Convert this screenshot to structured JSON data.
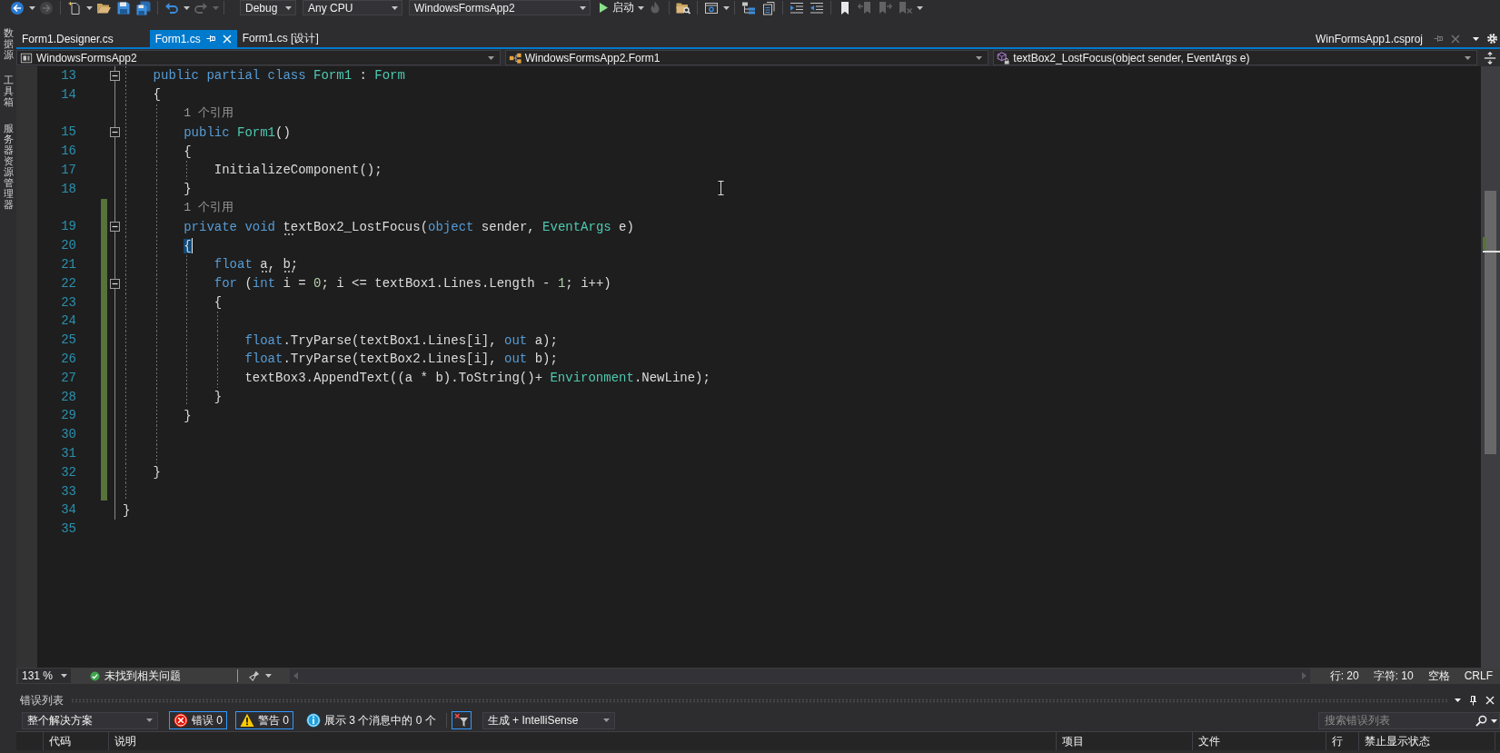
{
  "toolbar": [
    {
      "kind": "back",
      "disabled": false
    },
    {
      "kind": "caret",
      "disabled": false
    },
    {
      "kind": "forward",
      "disabled": true
    },
    {
      "kind": "separator"
    },
    {
      "kind": "new-item",
      "disabled": false
    },
    {
      "kind": "caret",
      "disabled": false
    },
    {
      "kind": "open",
      "disabled": false
    },
    {
      "kind": "save",
      "disabled": false
    },
    {
      "kind": "save-all",
      "disabled": false
    },
    {
      "kind": "separator"
    },
    {
      "kind": "undo",
      "disabled": false
    },
    {
      "kind": "caret",
      "disabled": false
    },
    {
      "kind": "redo",
      "disabled": true
    },
    {
      "kind": "caret",
      "disabled": true
    },
    {
      "kind": "separator"
    },
    {
      "kind": "combo",
      "value": "Debug"
    },
    {
      "kind": "combo",
      "value": "Any CPU"
    },
    {
      "kind": "combo",
      "value": "WindowsFormsApp2"
    },
    {
      "kind": "start",
      "label": "启动"
    },
    {
      "kind": "caret",
      "disabled": false
    },
    {
      "kind": "hot-reload",
      "disabled": true
    },
    {
      "kind": "separator"
    },
    {
      "kind": "find-in-files",
      "disabled": false
    },
    {
      "kind": "separator"
    },
    {
      "kind": "browser",
      "disabled": false
    },
    {
      "kind": "caret",
      "disabled": false
    },
    {
      "kind": "separator"
    },
    {
      "kind": "hierarchy",
      "disabled": false
    },
    {
      "kind": "pages",
      "disabled": false
    },
    {
      "kind": "separator"
    },
    {
      "kind": "indent",
      "disabled": false
    },
    {
      "kind": "outdent",
      "disabled": false
    },
    {
      "kind": "separator"
    },
    {
      "kind": "bookmark",
      "disabled": false
    },
    {
      "kind": "bookmark-previous",
      "disabled": true
    },
    {
      "kind": "bookmark-next",
      "disabled": true
    },
    {
      "kind": "bookmark-clear",
      "disabled": true
    },
    {
      "kind": "caret",
      "disabled": false
    }
  ],
  "side_tabs": [
    "数据源",
    "工具箱",
    "服务器资源管理器"
  ],
  "tabs": [
    {
      "label": "Form1.Designer.cs",
      "selected": false
    },
    {
      "label": "Form1.cs",
      "selected": true
    },
    {
      "label": "Form1.cs [设计]",
      "selected": false
    }
  ],
  "preview_tab": {
    "label": "WinFormsApp1.csproj"
  },
  "nav_bar": [
    {
      "kind": "project",
      "value": "WindowsFormsApp2"
    },
    {
      "kind": "class",
      "value": "WindowsFormsApp2.Form1"
    },
    {
      "kind": "member",
      "value": "textBox2_LostFocus(object sender, EventArgs e)"
    }
  ],
  "editor": {
    "lines": [
      {
        "kind": "block",
        "children": [
          {
            "kind": "code",
            "number": "13",
            "modified": false,
            "expanded": true,
            "tokens": [
              {
                "kind": "kw",
                "text": "public partial class "
              },
              {
                "kind": "type",
                "text": "Form1"
              },
              {
                "kind": "plain",
                "text": " : "
              },
              {
                "kind": "type",
                "text": "Form"
              }
            ]
          },
          {
            "kind": "code",
            "number": "14",
            "modified": false,
            "tokens": [
              {
                "kind": "plain",
                "text": "{"
              }
            ],
            "children": [
              {
                "kind": "codelens",
                "text": "1 个引用",
                "modified": false
              },
              {
                "kind": "code",
                "number": "15",
                "modified": false,
                "expanded": true,
                "tokens": [
                  {
                    "kind": "kw",
                    "text": "public "
                  },
                  {
                    "kind": "type",
                    "text": "Form1"
                  },
                  {
                    "kind": "plain",
                    "text": "()"
                  }
                ]
              },
              {
                "kind": "code",
                "number": "16",
                "modified": false,
                "tokens": [
                  {
                    "kind": "plain",
                    "text": "{"
                  }
                ],
                "children": [
                  {
                    "kind": "code",
                    "number": "17",
                    "modified": false,
                    "tokens": [
                      {
                        "kind": "plain",
                        "text": "InitializeComponent();"
                      }
                    ]
                  }
                ]
              },
              {
                "kind": "code",
                "number": "18",
                "modified": false,
                "tokens": [
                  {
                    "kind": "plain",
                    "text": "}"
                  }
                ]
              },
              {
                "kind": "codelens",
                "text": "1 个引用",
                "modified": true
              },
              {
                "kind": "code",
                "number": "19",
                "modified": true,
                "expanded": true,
                "tokens": [
                  {
                    "kind": "kw",
                    "text": "private void "
                  },
                  {
                    "kind": "hint",
                    "text": "textBox2_LostFocus"
                  },
                  {
                    "kind": "plain",
                    "text": "("
                  },
                  {
                    "kind": "kw",
                    "text": "object"
                  },
                  {
                    "kind": "plain",
                    "text": " sender, "
                  },
                  {
                    "kind": "type",
                    "text": "EventArgs"
                  },
                  {
                    "kind": "plain",
                    "text": " e)"
                  }
                ]
              },
              {
                "kind": "code",
                "number": "20",
                "modified": true,
                "cursor": true,
                "tokens": [
                  {
                    "kind": "brace-match",
                    "text": "{"
                  }
                ],
                "children": [
                  {
                    "kind": "code",
                    "number": "21",
                    "modified": true,
                    "tokens": [
                      {
                        "kind": "kw",
                        "text": "float "
                      },
                      {
                        "kind": "hint",
                        "text": "a"
                      },
                      {
                        "kind": "plain",
                        "text": ", "
                      },
                      {
                        "kind": "hint",
                        "text": "b"
                      },
                      {
                        "kind": "plain",
                        "text": ";"
                      }
                    ]
                  },
                  {
                    "kind": "code",
                    "number": "22",
                    "modified": true,
                    "expanded": true,
                    "tokens": [
                      {
                        "kind": "kw",
                        "text": "for"
                      },
                      {
                        "kind": "plain",
                        "text": " ("
                      },
                      {
                        "kind": "kw",
                        "text": "int"
                      },
                      {
                        "kind": "plain",
                        "text": " i = "
                      },
                      {
                        "kind": "num",
                        "text": "0"
                      },
                      {
                        "kind": "plain",
                        "text": "; i <= textBox1.Lines.Length - "
                      },
                      {
                        "kind": "num",
                        "text": "1"
                      },
                      {
                        "kind": "plain",
                        "text": "; i++)"
                      }
                    ]
                  },
                  {
                    "kind": "code",
                    "number": "23",
                    "modified": true,
                    "tokens": [
                      {
                        "kind": "plain",
                        "text": "{"
                      }
                    ],
                    "children": [
                      {
                        "kind": "code",
                        "number": "24",
                        "modified": true
                      },
                      {
                        "kind": "code",
                        "number": "25",
                        "modified": true,
                        "tokens": [
                          {
                            "kind": "kw",
                            "text": "float"
                          },
                          {
                            "kind": "plain",
                            "text": ".TryParse(textBox1.Lines[i], "
                          },
                          {
                            "kind": "kw",
                            "text": "out"
                          },
                          {
                            "kind": "plain",
                            "text": " a);"
                          }
                        ]
                      },
                      {
                        "kind": "code",
                        "number": "26",
                        "modified": true,
                        "tokens": [
                          {
                            "kind": "kw",
                            "text": "float"
                          },
                          {
                            "kind": "plain",
                            "text": ".TryParse(textBox2.Lines[i], "
                          },
                          {
                            "kind": "kw",
                            "text": "out"
                          },
                          {
                            "kind": "plain",
                            "text": " b);"
                          }
                        ]
                      },
                      {
                        "kind": "code",
                        "number": "27",
                        "modified": true,
                        "tokens": [
                          {
                            "kind": "plain",
                            "text": "textBox3.AppendText((a * b).ToString()+ "
                          },
                          {
                            "kind": "type",
                            "text": "Environment"
                          },
                          {
                            "kind": "plain",
                            "text": ".NewLine);"
                          }
                        ]
                      }
                    ]
                  },
                  {
                    "kind": "code",
                    "number": "28",
                    "modified": true,
                    "tokens": [
                      {
                        "kind": "plain",
                        "text": "}"
                      }
                    ]
                  }
                ]
              },
              {
                "kind": "code",
                "number": "29",
                "modified": true,
                "tokens": [
                  {
                    "kind": "plain",
                    "text": "}"
                  }
                ]
              },
              {
                "kind": "code",
                "number": "30",
                "modified": true
              },
              {
                "kind": "code",
                "number": "31",
                "modified": true
              }
            ]
          },
          {
            "kind": "code",
            "number": "32",
            "modified": true,
            "tokens": [
              {
                "kind": "plain",
                "text": "}"
              }
            ]
          },
          {
            "kind": "code",
            "number": "33",
            "modified": true
          }
        ]
      },
      {
        "kind": "code",
        "number": "34",
        "modified": false,
        "tokens": [
          {
            "kind": "plain",
            "text": "}"
          }
        ]
      },
      {
        "kind": "code",
        "number": "35",
        "modified": false
      }
    ],
    "status": {
      "zoom": "131 %",
      "issues": "未找到相关问题",
      "line": "行: 20",
      "column": "字符: 10",
      "indent": "空格",
      "line_ending": "CRLF"
    }
  },
  "error_list": {
    "title": "错误列表",
    "scope": "整个解决方案",
    "filters": [
      {
        "kind": "error",
        "label": "错误 0",
        "on": true
      },
      {
        "kind": "warning",
        "label": "警告 0",
        "on": true
      },
      {
        "kind": "message",
        "label": "展示 3 个消息中的 0 个",
        "on": false
      }
    ],
    "filter_button": {
      "on": true
    },
    "source": "生成 + IntelliSense",
    "search": {
      "placeholder": "搜索错误列表"
    },
    "columns": [
      "代码",
      "说明",
      "项目",
      "文件",
      "行",
      "禁止显示状态"
    ]
  }
}
